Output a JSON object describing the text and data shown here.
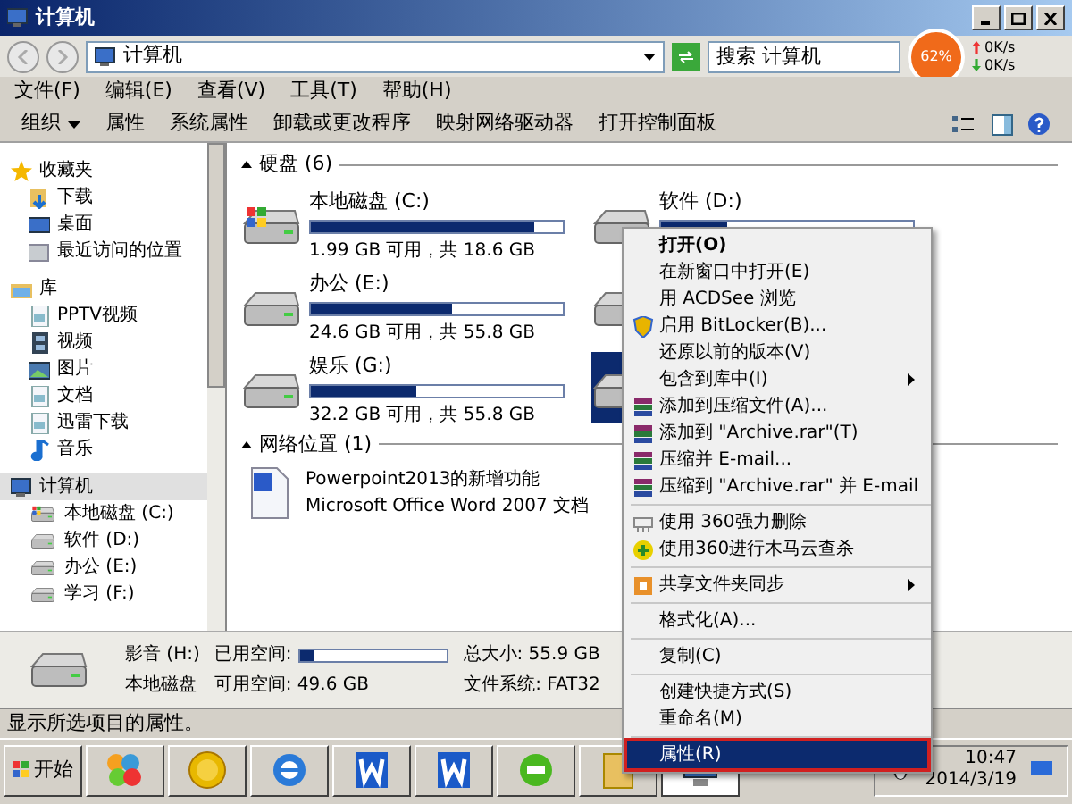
{
  "window": {
    "title": "计算机"
  },
  "address": {
    "path": "计算机",
    "search_placeholder": "搜索 计算机"
  },
  "speed_widget": {
    "percent": "62%",
    "upload": "0K/s",
    "download": "0K/s"
  },
  "menu_bar": [
    "文件(F)",
    "编辑(E)",
    "查看(V)",
    "工具(T)",
    "帮助(H)"
  ],
  "toolbar": [
    {
      "label": "组织",
      "dropdown": true
    },
    {
      "label": "属性",
      "dropdown": false
    },
    {
      "label": "系统属性",
      "dropdown": false
    },
    {
      "label": "卸载或更改程序",
      "dropdown": false
    },
    {
      "label": "映射网络驱动器",
      "dropdown": false
    },
    {
      "label": "打开控制面板",
      "dropdown": false
    }
  ],
  "sidebar": [
    {
      "label": "收藏夹",
      "kind": "star",
      "selected": false,
      "children": [
        {
          "label": "下载",
          "kind": "download"
        },
        {
          "label": "桌面",
          "kind": "desktop"
        },
        {
          "label": "最近访问的位置",
          "kind": "recent"
        }
      ]
    },
    {
      "label": "库",
      "kind": "library",
      "selected": false,
      "children": [
        {
          "label": "PPTV视频",
          "kind": "doc"
        },
        {
          "label": "视频",
          "kind": "video"
        },
        {
          "label": "图片",
          "kind": "picture"
        },
        {
          "label": "文档",
          "kind": "doc"
        },
        {
          "label": "迅雷下载",
          "kind": "doc"
        },
        {
          "label": "音乐",
          "kind": "music"
        }
      ]
    },
    {
      "label": "计算机",
      "kind": "computer",
      "selected": true,
      "children": [
        {
          "label": "本地磁盘 (C:)",
          "kind": "windrive"
        },
        {
          "label": "软件 (D:)",
          "kind": "drive"
        },
        {
          "label": "办公 (E:)",
          "kind": "drive"
        },
        {
          "label": "学习 (F:)",
          "kind": "drive"
        }
      ]
    }
  ],
  "hard_disks": {
    "heading": "硬盘 (6)",
    "drives": [
      {
        "kind": "system",
        "name": "本地磁盘 (C:)",
        "level": 0.89,
        "free": "1.99 GB 可用，共 18.6 GB",
        "selected": false
      },
      {
        "kind": "plain",
        "name": "软件 (D:)",
        "level": 0.26,
        "selected": false
      },
      {
        "kind": "plain",
        "name": "办公 (E:)",
        "level": 0.56,
        "free": "24.6 GB 可用，共 55.8 GB",
        "selected": false
      },
      {
        "kind": "plain",
        "selected": false
      },
      {
        "kind": "plain",
        "name": "娱乐 (G:)",
        "level": 0.42,
        "free": "32.2 GB 可用，共 55.8 GB",
        "selected": false
      },
      {
        "kind": "plain",
        "selected": true
      }
    ]
  },
  "network": {
    "heading": "网络位置 (1)",
    "items": [
      {
        "name": "Powerpoint2013的新增功能",
        "type": "Microsoft Office Word 2007 文档"
      }
    ]
  },
  "context_menu": [
    {
      "kind": "plain",
      "label": "打开(O)",
      "bold": true,
      "submenu": false,
      "selected": false
    },
    {
      "kind": "plain",
      "label": "在新窗口中打开(E)",
      "bold": false,
      "submenu": false,
      "selected": false
    },
    {
      "kind": "plain",
      "label": "用 ACDSee 浏览",
      "bold": false,
      "submenu": false,
      "selected": false
    },
    {
      "kind": "shield",
      "label": "启用 BitLocker(B)...",
      "bold": false,
      "submenu": false,
      "selected": false
    },
    {
      "kind": "plain",
      "label": "还原以前的版本(V)",
      "bold": false,
      "submenu": false,
      "selected": false
    },
    {
      "kind": "plain",
      "label": "包含到库中(I)",
      "bold": false,
      "submenu": true,
      "selected": false
    },
    {
      "kind": "archive",
      "label": "添加到压缩文件(A)...",
      "bold": false,
      "submenu": false,
      "selected": false
    },
    {
      "kind": "archive",
      "label": "添加到 \"Archive.rar\"(T)",
      "bold": false,
      "submenu": false,
      "selected": false
    },
    {
      "kind": "archive",
      "label": "压缩并 E-mail...",
      "bold": false,
      "submenu": false,
      "selected": false
    },
    {
      "kind": "archive",
      "label": "压缩到 \"Archive.rar\" 并 E-mail",
      "bold": false,
      "submenu": false,
      "selected": false
    },
    {
      "kind": "separator"
    },
    {
      "kind": "shredder",
      "label": "使用 360强力删除",
      "bold": false,
      "submenu": false,
      "selected": false
    },
    {
      "kind": "scan",
      "label": "使用360进行木马云查杀",
      "bold": false,
      "submenu": false,
      "selected": false
    },
    {
      "kind": "separator"
    },
    {
      "kind": "sync",
      "label": "共享文件夹同步",
      "bold": false,
      "submenu": true,
      "selected": false
    },
    {
      "kind": "separator"
    },
    {
      "kind": "plain",
      "label": "格式化(A)...",
      "bold": false,
      "submenu": false,
      "selected": false
    },
    {
      "kind": "separator"
    },
    {
      "kind": "plain",
      "label": "复制(C)",
      "bold": false,
      "submenu": false,
      "selected": false
    },
    {
      "kind": "separator"
    },
    {
      "kind": "plain",
      "label": "创建快捷方式(S)",
      "bold": false,
      "submenu": false,
      "selected": false
    },
    {
      "kind": "plain",
      "label": "重命名(M)",
      "bold": false,
      "submenu": false,
      "selected": false
    },
    {
      "kind": "separator"
    },
    {
      "kind": "plain",
      "label": "属性(R)",
      "bold": false,
      "submenu": false,
      "selected": true
    }
  ],
  "details": {
    "name": "影音 (H:)",
    "type": "本地磁盘",
    "used_label": "已用空间:",
    "level": 0.1,
    "free": "可用空间: 49.6 GB",
    "total": "总大小: 55.9 GB",
    "filesystem": "文件系统: FAT32"
  },
  "status_bar": "显示所选项目的属性。",
  "taskbar": {
    "start": "开始",
    "apps": [
      {
        "kind": "balls",
        "selected": false
      },
      {
        "kind": "coin",
        "selected": false
      },
      {
        "kind": "ie",
        "selected": false
      },
      {
        "kind": "word",
        "selected": false
      },
      {
        "kind": "word",
        "selected": false
      },
      {
        "kind": "green",
        "selected": false
      },
      {
        "kind": "folder",
        "selected": false
      },
      {
        "kind": "computer",
        "selected": true
      }
    ],
    "time": "10:47",
    "date": "2014/3/19"
  }
}
